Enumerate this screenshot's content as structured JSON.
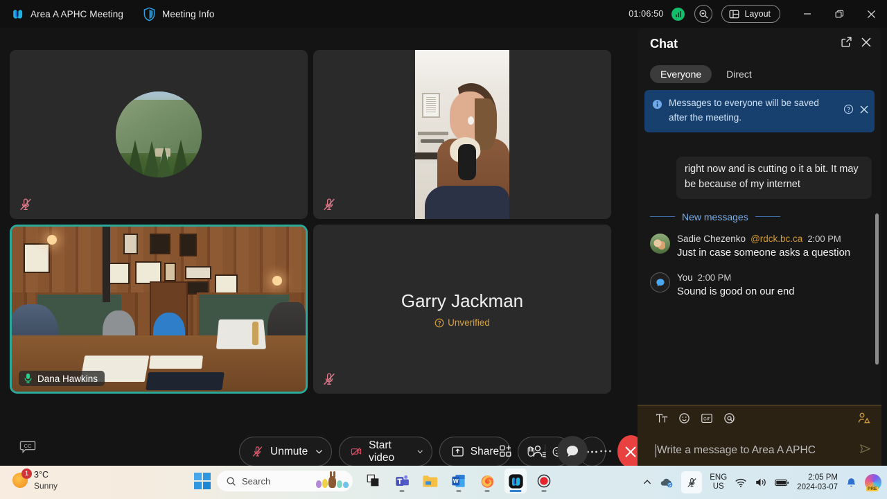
{
  "titlebar": {
    "meeting_name": "Area A APHC Meeting",
    "meeting_info_label": "Meeting Info",
    "timer": "01:06:50",
    "layout_label": "Layout",
    "icons": {
      "webex": "webex-logo-icon",
      "shield": "meeting-info-shield-icon",
      "network": "network-quality-icon",
      "zoom": "zoom-in-icon",
      "layout": "layout-grid-icon",
      "minimize": "minimize-icon",
      "restore": "restore-icon",
      "close": "close-icon"
    }
  },
  "stage": {
    "tiles": [
      {
        "name": "participant-avatar-tile",
        "kind": "avatar",
        "muted": true,
        "label": ""
      },
      {
        "name": "participant-video-tile",
        "kind": "video-person",
        "muted": true,
        "label": ""
      },
      {
        "name": "dana-hawkins-tile",
        "kind": "video-room",
        "muted": false,
        "label": "Dana Hawkins",
        "active": true
      },
      {
        "name": "garry-jackman-tile",
        "kind": "name-only",
        "muted": true,
        "label": "Garry Jackman",
        "status": "Unverified"
      }
    ]
  },
  "controls": {
    "cc_label": "cc",
    "unmute_label": "Unmute",
    "start_video_label": "Start video",
    "share_label": "Share",
    "raise_hand": "raise-hand-icon",
    "reactions": "reactions-icon",
    "more": "more-options-icon",
    "end_call": "end-call-icon",
    "apps": "apps-icon",
    "participants": "participants-icon",
    "chat": "chat-icon",
    "more_right": "more-icon"
  },
  "chat": {
    "title": "Chat",
    "popout_icon": "popout-icon",
    "close_icon": "close-icon",
    "tabs": [
      {
        "label": "Everyone",
        "selected": true
      },
      {
        "label": "Direct",
        "selected": false
      }
    ],
    "banner": {
      "text": "Messages to everyone will be saved after the meeting.",
      "info_icon": "info-icon",
      "help_icon": "help-circle-icon",
      "close_icon": "close-icon"
    },
    "partial_message": "right now and is cutting o it a bit. It may be because of my internet",
    "new_messages_divider": "New messages",
    "messages": [
      {
        "author": "Sadie Chezenko",
        "domain": "@rdck.bc.ca",
        "time": "2:00 PM",
        "text": "Just in case someone asks a question",
        "avatar": "photo"
      },
      {
        "author": "You",
        "domain": "",
        "time": "2:00 PM",
        "text": "Sound is good on our end",
        "avatar": "you"
      }
    ],
    "composer": {
      "placeholder": "Write a message to Area A APHC",
      "value": "",
      "tools": [
        "format-text-icon",
        "emoji-icon",
        "gif-icon",
        "mention-icon"
      ],
      "attach_icon": "attach-person-icon",
      "send_icon": "send-icon"
    }
  },
  "taskbar": {
    "weather": {
      "temp": "3°C",
      "condition": "Sunny",
      "badge": "1"
    },
    "start_icon": "windows-start-icon",
    "search_placeholder": "Search",
    "apps": [
      {
        "name": "task-view-icon"
      },
      {
        "name": "microsoft-teams-icon"
      },
      {
        "name": "file-explorer-icon"
      },
      {
        "name": "microsoft-word-icon"
      },
      {
        "name": "firefox-icon"
      },
      {
        "name": "webex-icon",
        "active": true
      },
      {
        "name": "screen-recorder-icon"
      }
    ],
    "tray": {
      "chevron": "show-hidden-icons-icon",
      "onedrive": "onedrive-sync-icon",
      "mic_muted": "microphone-muted-icon",
      "language": "ENG",
      "region": "US",
      "wifi": "wifi-icon",
      "volume": "volume-icon",
      "battery": "battery-icon",
      "time": "2:05 PM",
      "date": "2024-03-07",
      "notifications": "notifications-bell-icon",
      "copilot": "copilot-icon",
      "copilot_badge": "PRE"
    }
  },
  "colors": {
    "accent_teal": "#2aa89a",
    "end_red": "#e8413f",
    "banner_blue": "#17406f",
    "warn_amber": "#d99f36",
    "composer_bg": "#2b2213"
  }
}
